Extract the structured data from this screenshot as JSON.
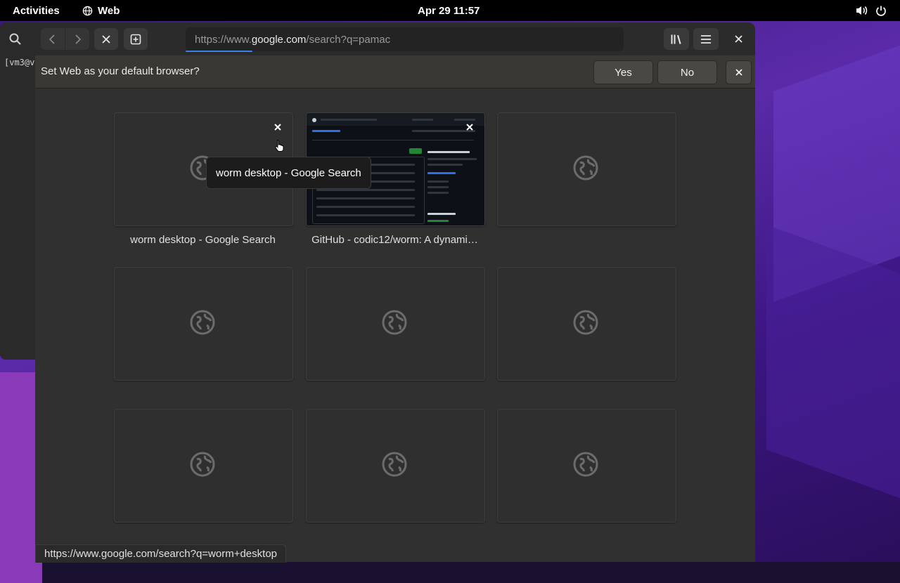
{
  "topbar": {
    "activities": "Activities",
    "app_name": "Web",
    "clock": "Apr 29  11:57"
  },
  "terminal": {
    "prompt_text": "[vm3@v"
  },
  "browser": {
    "url_prefix": "https://www.",
    "url_host": "google.com",
    "url_path": "/search?q=pamac"
  },
  "infobar": {
    "message": "Set Web as your default browser?",
    "yes_label": "Yes",
    "no_label": "No"
  },
  "overview": {
    "tiles": [
      {
        "title": "worm desktop - Google Search"
      },
      {
        "title": "GitHub - codic12/worm: A dynami…"
      },
      {
        "title": ""
      },
      {
        "title": ""
      },
      {
        "title": ""
      },
      {
        "title": ""
      },
      {
        "title": ""
      },
      {
        "title": ""
      },
      {
        "title": ""
      }
    ]
  },
  "tooltip": {
    "text": "worm desktop - Google Search"
  },
  "statusbar": {
    "link_url": "https://www.google.com/search?q=worm+desktop"
  },
  "colors": {
    "accent": "#3584e4",
    "headerbar": "#2b2b2b",
    "infobar": "#3a3832"
  },
  "icons": [
    "globe-icon",
    "search-icon",
    "back-icon",
    "forward-icon",
    "stop-icon",
    "new-tab-icon",
    "star-icon",
    "library-icon",
    "menu-icon",
    "close-icon",
    "volume-icon",
    "power-icon"
  ]
}
